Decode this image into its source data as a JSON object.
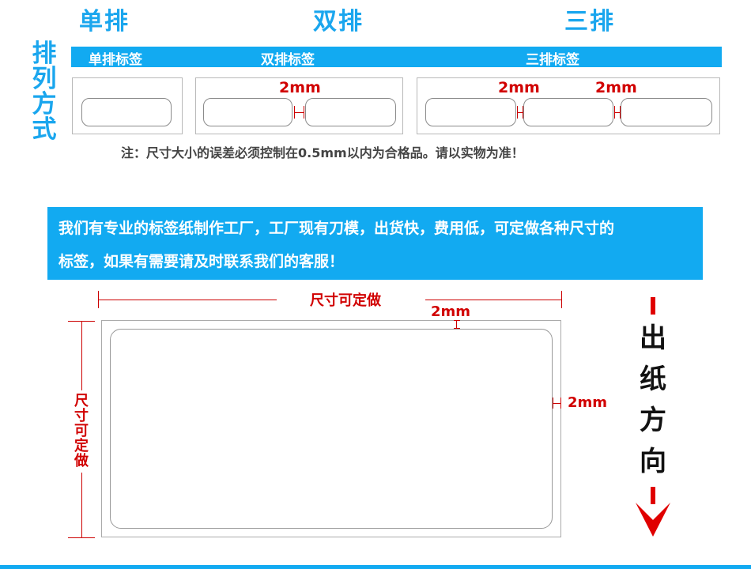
{
  "headings": {
    "single": "单排",
    "double": "双排",
    "triple": "三排"
  },
  "side_title": [
    "排",
    "列",
    "方",
    "式"
  ],
  "bar_labels": {
    "single": "单排标签",
    "double": "双排标签",
    "triple": "三排标签"
  },
  "gap_label": "2mm",
  "note": "注：尺寸大小的误差必须控制在0.5mm以内为合格品。请以实物为准！",
  "banner": {
    "line1": "我们有专业的标签纸制作工厂，工厂现有刀模，出货快，费用低，可定做各种尺寸的",
    "line2": "标签，如果有需要请及时联系我们的客服！"
  },
  "diagram": {
    "width_label": "尺寸可定做",
    "height_label": [
      "尺",
      "寸",
      "可",
      "定",
      "做"
    ],
    "margin_top_label": "2mm",
    "margin_right_label": "2mm",
    "direction_label": [
      "出",
      "纸",
      "方",
      "向"
    ]
  },
  "colors": {
    "accent_blue": "#12aaf1",
    "title_blue": "#1aa6ee",
    "dimension_red": "#d10000"
  }
}
